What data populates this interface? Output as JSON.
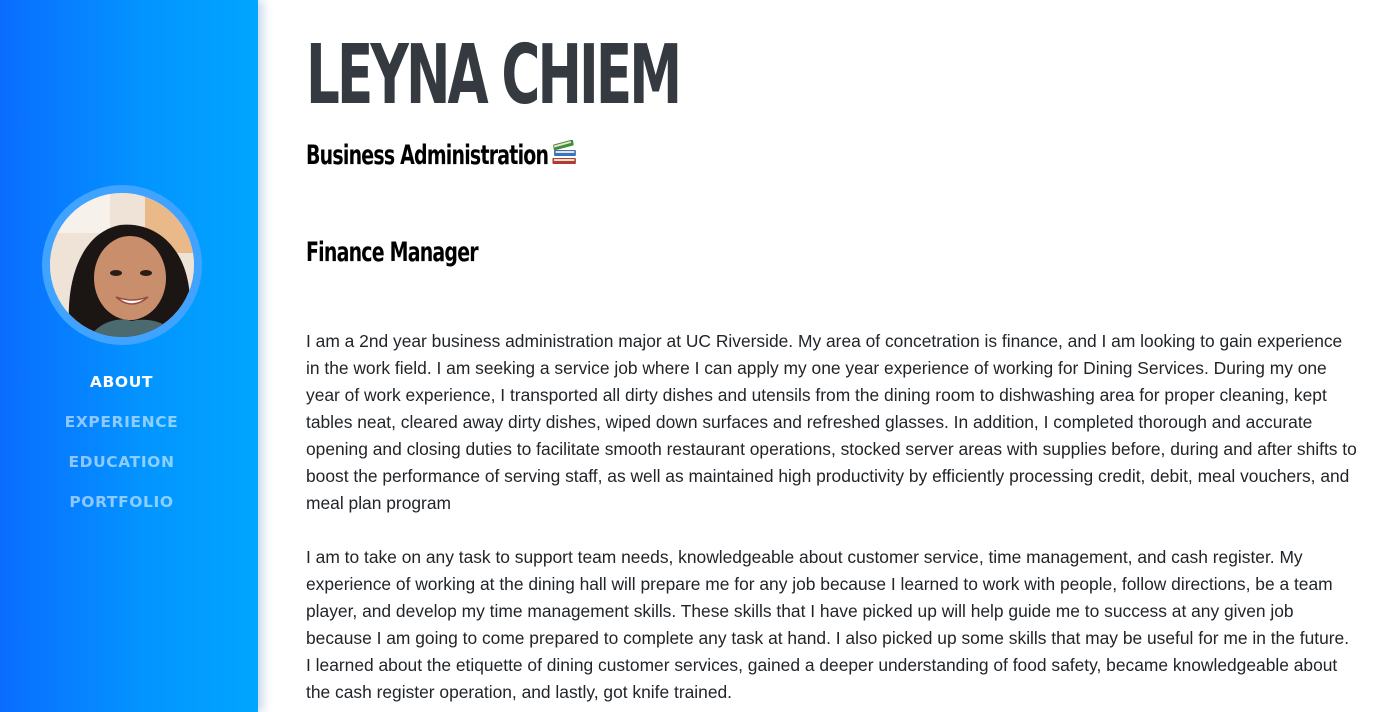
{
  "profile": {
    "name": "LEYNA CHIEM",
    "subtitle": "Business Administration",
    "subtitle_icon": "books-icon",
    "role": "Finance Manager"
  },
  "nav": {
    "items": [
      {
        "label": "ABOUT",
        "active": true
      },
      {
        "label": "EXPERIENCE",
        "active": false
      },
      {
        "label": "EDUCATION",
        "active": false
      },
      {
        "label": "PORTFOLIO",
        "active": false
      }
    ]
  },
  "about": {
    "paragraph1": "I am a 2nd year business administration major at UC Riverside. My area of concetration is finance, and I am looking to gain experience in the work field. I am seeking a service job where I can apply my one year experience of working for Dining Services. During my one year of work experience, I transported all dirty dishes and utensils from the dining room to dishwashing area for proper cleaning, kept tables neat, cleared away dirty dishes, wiped down surfaces and refreshed glasses. In addition, I completed thorough and accurate opening and closing duties to facilitate smooth restaurant operations, stocked server areas with supplies before, during and after shifts to boost the performance of serving staff, as well as maintained high productivity by efficiently processing credit, debit, meal vouchers, and meal plan program",
    "paragraph2": "I am to take on any task to support team needs, knowledgeable about customer service, time management, and cash register. My experience of working at the dining hall will prepare me for any job because I learned to work with people, follow directions, be a team player, and develop my time management skills. These skills that I have picked up will help guide me to success at any given job because I am going to come prepared to complete any task at hand. I also picked up some skills that may be useful for me in the future. I learned about the etiquette of dining customer services, gained a deeper understanding of food safety, became knowledgeable about the cash register operation, and lastly, got knife trained."
  },
  "colors": {
    "sidebar_start": "#0a6cff",
    "sidebar_end": "#00a6ff",
    "heading": "#343a40",
    "text": "#212529"
  }
}
